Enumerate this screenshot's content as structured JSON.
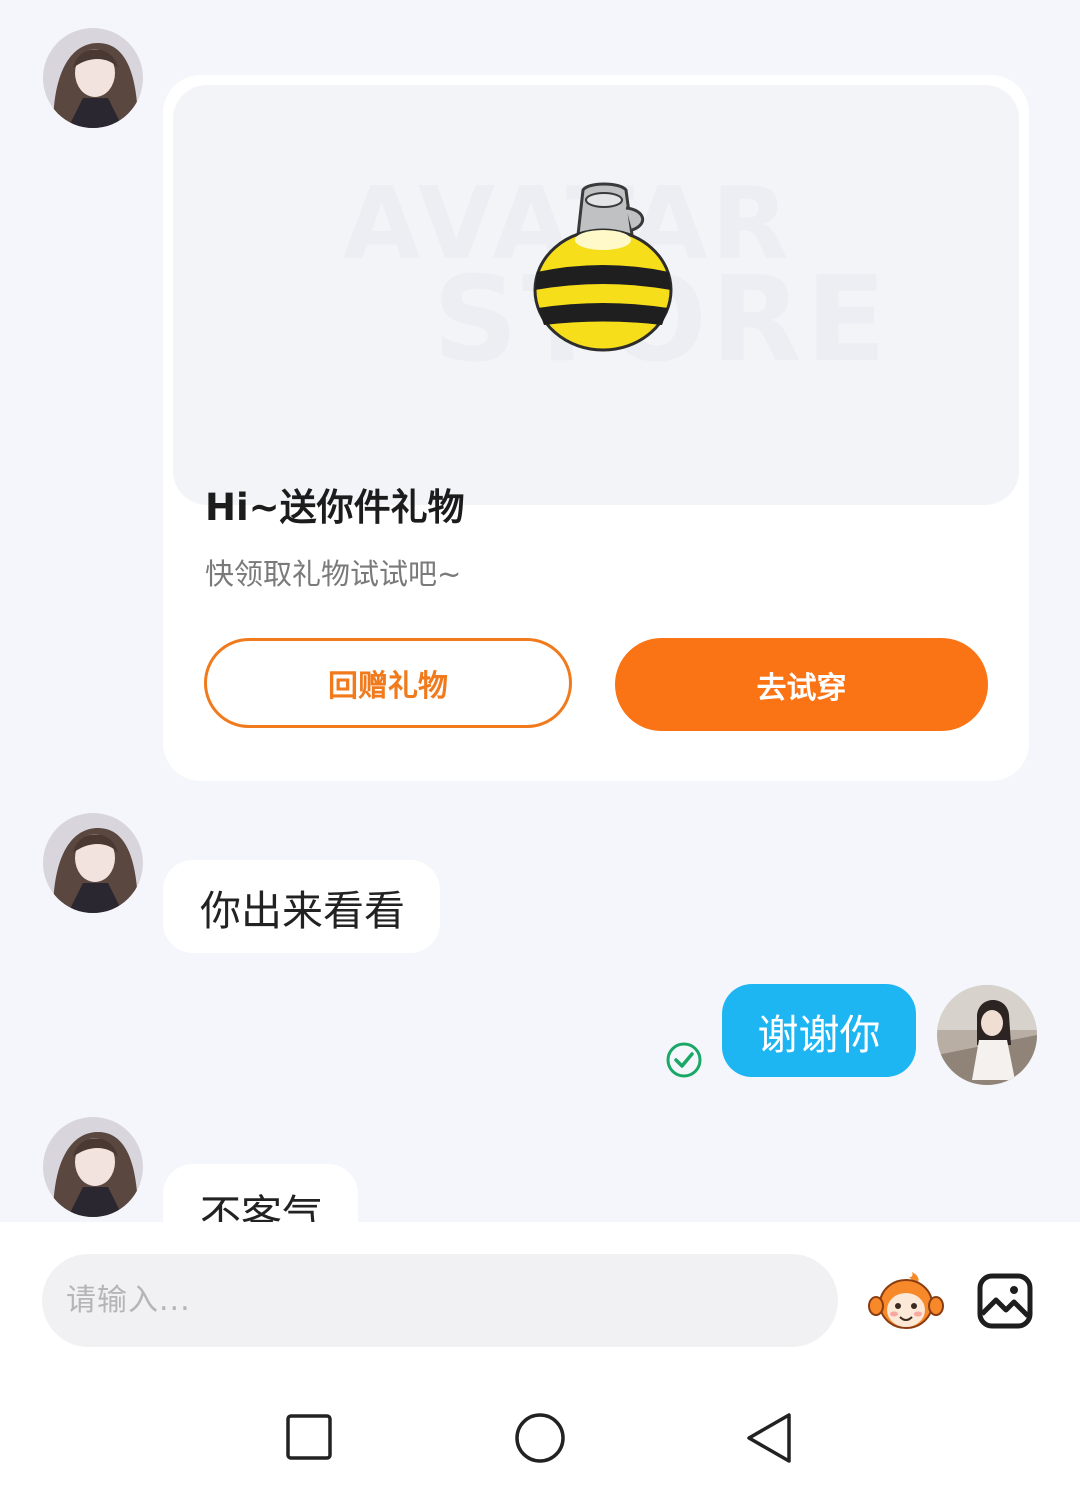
{
  "gift_card": {
    "title": "Hi~送你件礼物",
    "subtitle": "快领取礼物试试吧~",
    "watermark_line1": "AVATAR",
    "watermark_line2": "STORE",
    "return_gift_label": "回赠礼物",
    "try_on_label": "去试穿",
    "item_icon": "bee-pendant-icon"
  },
  "messages": [
    {
      "from": "other",
      "text": "你出来看看"
    },
    {
      "from": "self",
      "text": "谢谢你",
      "status": "read"
    },
    {
      "from": "other",
      "text": "不客气"
    }
  ],
  "input": {
    "placeholder": "请输入..."
  },
  "toolbar": {
    "emoji_icon": "monkey-emoji-icon",
    "image_icon": "image-icon"
  },
  "nav": {
    "icons": [
      "recent-apps-icon",
      "home-icon",
      "back-icon"
    ]
  },
  "colors": {
    "accent_orange": "#fa7314",
    "outgoing_bubble": "#1eb5f3",
    "read_check": "#1aa866",
    "background": "#f4f6fb"
  }
}
